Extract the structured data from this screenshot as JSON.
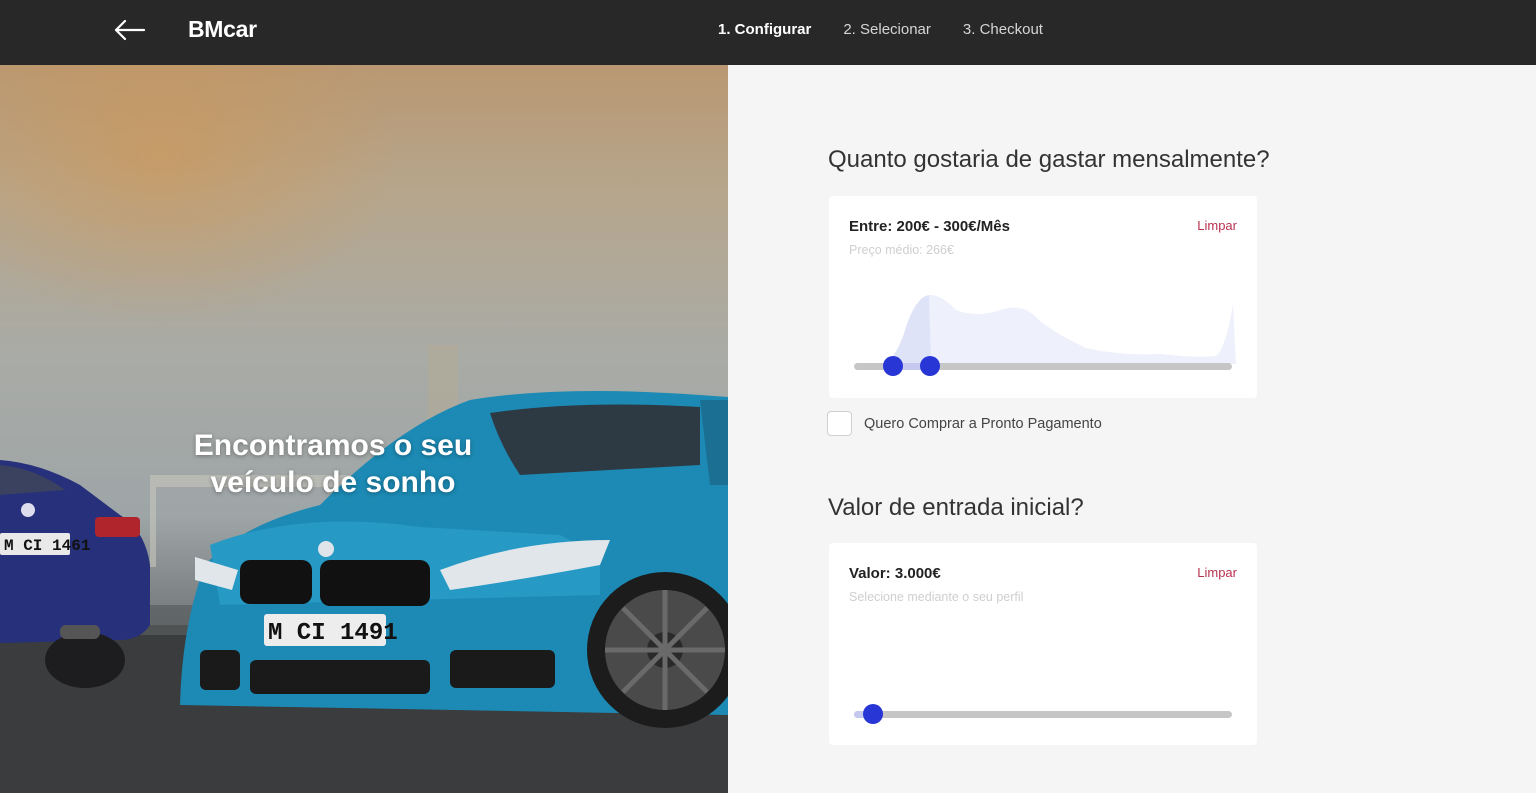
{
  "header": {
    "brand": "BMcar",
    "back_icon": "arrow-left-icon",
    "steps": [
      {
        "label": "1. Configurar",
        "active": true
      },
      {
        "label": "2. Selecionar",
        "active": false
      },
      {
        "label": "3. Checkout",
        "active": false
      }
    ]
  },
  "hero": {
    "title": "Encontramos o seu veículo de sonho",
    "plates": [
      "M CI 1491",
      "M CI 1461"
    ]
  },
  "monthly": {
    "question": "Quanto gostaria de gastar mensalmente?",
    "label": "Entre: 200€ - 300€/Mês",
    "sub": "Preço médio: 266€",
    "clear": "Limpar",
    "range_low_fraction": 0.1,
    "range_high_fraction": 0.2
  },
  "cash_payment": {
    "label": "Quero Comprar a Pronto Pagamento",
    "checked": false
  },
  "down_payment": {
    "question": "Valor de entrada inicial?",
    "label": "Valor: 3.000€",
    "sub": "Selecione mediante o seu perfil",
    "clear": "Limpar",
    "value_fraction": 0.05
  },
  "colors": {
    "topbar": "#282828",
    "accent": "#2836d6",
    "clear_link": "#b8324f"
  }
}
